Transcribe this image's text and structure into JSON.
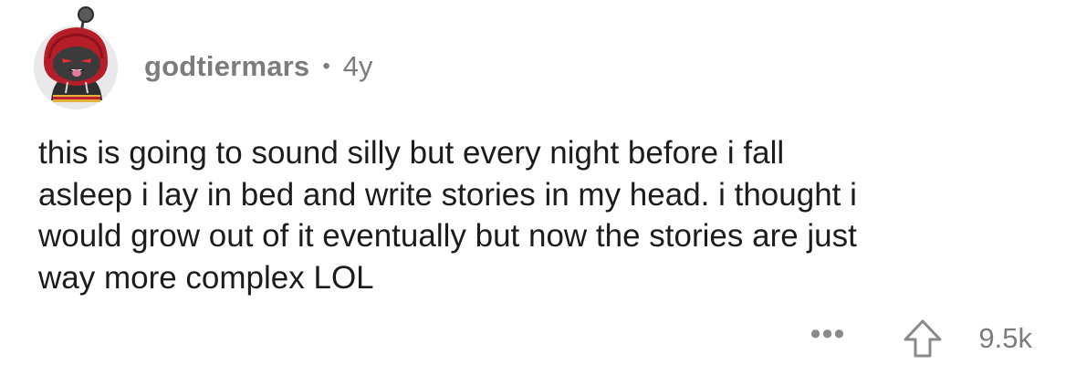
{
  "comment": {
    "username": "godtiermars",
    "separator": "•",
    "age": "4y",
    "text": "this is going to sound silly but every night before i fall\nasleep i lay in bed and write stories in my head. i thought i\nwould grow out of it eventually but now the stories are just\nway more complex LOL",
    "more_label": "•••",
    "score": "9.5k"
  },
  "icons": {
    "avatar": "snoo-avatar-red-hood",
    "upvote": "upvote-arrow-icon",
    "more": "more-options-icon"
  },
  "colors": {
    "meta_text": "#7c7c7c",
    "body_text": "#1c1c1c",
    "icon_gray": "#8a8a8a",
    "hood_red": "#c0202a"
  }
}
